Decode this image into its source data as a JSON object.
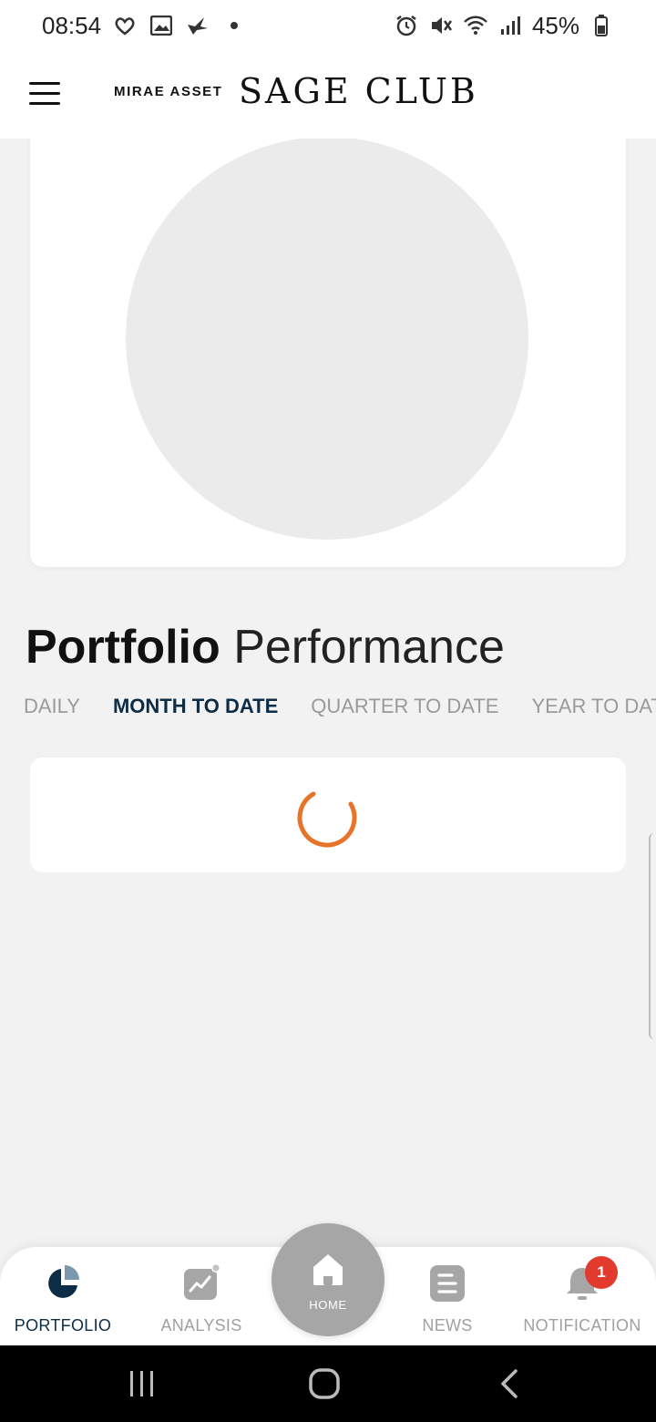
{
  "status_bar": {
    "time": "08:54",
    "battery": "45%",
    "left_icons": [
      "heart-link-icon",
      "image-icon",
      "bird-icon",
      "dot-icon"
    ],
    "right_icons": [
      "alarm-icon",
      "mute-icon",
      "wifi-icon",
      "signal-icon",
      "battery-icon"
    ]
  },
  "header": {
    "brand_small": "MIRAE ASSET",
    "brand_large": "SAGE CLUB",
    "menu_icon": "hamburger-icon"
  },
  "performance": {
    "title_bold": "Portfolio",
    "title_light": "Performance",
    "tabs": [
      {
        "label": "DAILY",
        "active": false
      },
      {
        "label": "MONTH TO DATE",
        "active": true
      },
      {
        "label": "QUARTER TO DATE",
        "active": false
      },
      {
        "label": "YEAR TO DAT",
        "active": false
      }
    ],
    "loading": true,
    "spinner_color": "#e8742a"
  },
  "bottom_nav": {
    "items": [
      {
        "label": "PORTFOLIO",
        "icon": "pie-chart-icon",
        "active": true
      },
      {
        "label": "ANALYSIS",
        "icon": "trend-chart-icon",
        "active": false
      },
      {
        "label": "NEWS",
        "icon": "news-icon",
        "active": false
      },
      {
        "label": "NOTIFICATION",
        "icon": "bell-icon",
        "active": false
      }
    ],
    "home_label": "HOME",
    "notification_count": "1"
  },
  "colors": {
    "accent": "#0d2c45",
    "inactive": "#a0a0a0",
    "badge": "#e23b2e",
    "spinner": "#e8742a"
  }
}
